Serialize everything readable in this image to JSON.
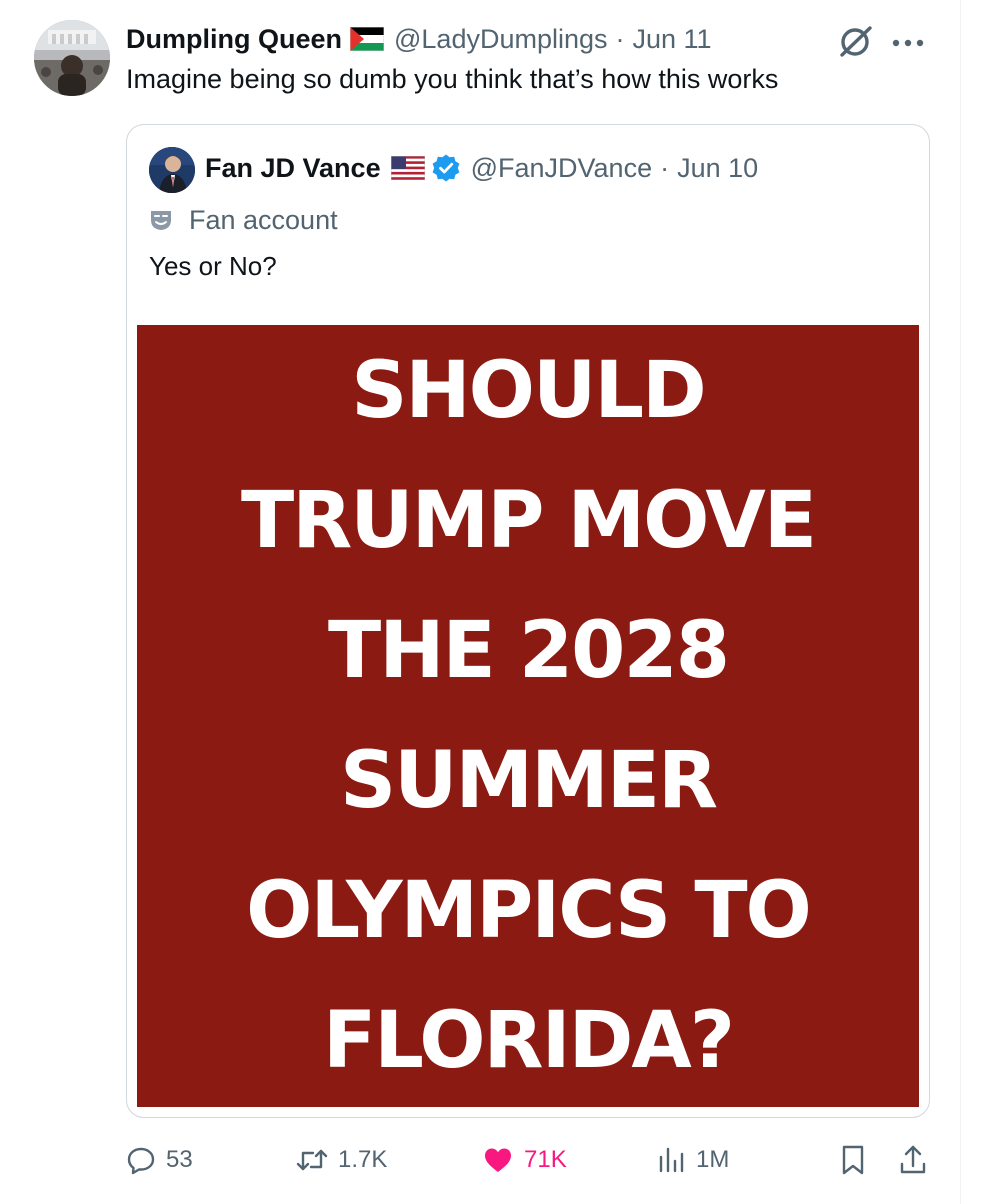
{
  "tweet": {
    "display_name": "Dumpling Queen",
    "flag": "palestine-flag",
    "handle": "@LadyDumplings",
    "separator": "·",
    "date": "Jun 11",
    "text": "Imagine being so dumb you think that’s how this works"
  },
  "quoted": {
    "display_name": "Fan JD Vance",
    "flag": "us-flag",
    "verified": true,
    "handle": "@FanJDVance",
    "separator": "·",
    "date": "Jun 10",
    "label": "Fan account",
    "text": "Yes or No?",
    "media": {
      "background": "#8b1a12",
      "lines": [
        "SHOULD",
        "TRUMP MOVE",
        "THE 2028",
        "SUMMER",
        "OLYMPICS TO",
        "FLORIDA?"
      ]
    }
  },
  "actions": {
    "replies": "53",
    "reposts": "1.7K",
    "likes": "71K",
    "views": "1M"
  },
  "colors": {
    "text_primary": "#0f1419",
    "text_secondary": "#536471",
    "like": "#f91880",
    "verified": "#1d9bf0",
    "border": "#cfd9de"
  }
}
